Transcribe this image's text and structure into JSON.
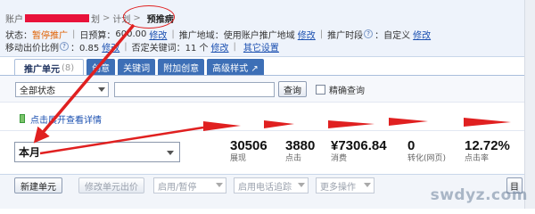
{
  "breadcrumb": {
    "account_label": "账户",
    "redacted_text": "",
    "segment_suffix": "划",
    "plan_label": "计划",
    "current": "预推病"
  },
  "status_row": {
    "status_label": "状态：",
    "status_value": "暂停推广",
    "budget_label": "日预算：",
    "budget_value": "600.00",
    "budget_edit": "修改",
    "region_label": "推广地域：",
    "region_value": "使用账户推广地域",
    "region_edit": "修改",
    "period_label": "推广时段",
    "period_value": "：自定义",
    "period_edit": "修改"
  },
  "bid_row": {
    "mobile_ratio_label": "移动出价比例",
    "mobile_ratio_value": "：0.85",
    "mobile_ratio_edit": "修改",
    "negative_label": "否定关键词",
    "negative_value": "：11 个",
    "negative_edit": "修改",
    "other_settings": "其它设置"
  },
  "tabs": [
    {
      "label": "推广单元",
      "count": "(8)"
    },
    {
      "label": "创意"
    },
    {
      "label": "关键词"
    },
    {
      "label": "附加创意"
    },
    {
      "label": "高级样式 ↗"
    }
  ],
  "filter": {
    "status_select": "全部状态",
    "search_value": "",
    "query_button": "查询",
    "exact_query_label": "精确查询"
  },
  "expand_link": "点击展开查看详情",
  "stats": {
    "period": "本月",
    "items": [
      {
        "value": "30506",
        "label": "展现"
      },
      {
        "value": "3880",
        "label": "点击"
      },
      {
        "value": "¥7306.84",
        "label": "消费"
      },
      {
        "value": "0",
        "label": "转化(网页)"
      },
      {
        "value": "12.72%",
        "label": "点击率"
      }
    ]
  },
  "toolbar": {
    "new_unit": "新建单元",
    "edit_bid": "修改单元出价",
    "enable_pause": "启用/暂停",
    "phone_tracking": "启用电话追踪",
    "more_actions": "更多操作",
    "right_button": "目"
  },
  "watermark": "swdyz.com",
  "colors": {
    "tab_blue": "#3d6fb6",
    "link_blue": "#1a4fb0",
    "annotation_red": "#e02020",
    "status_orange": "#e06000"
  }
}
